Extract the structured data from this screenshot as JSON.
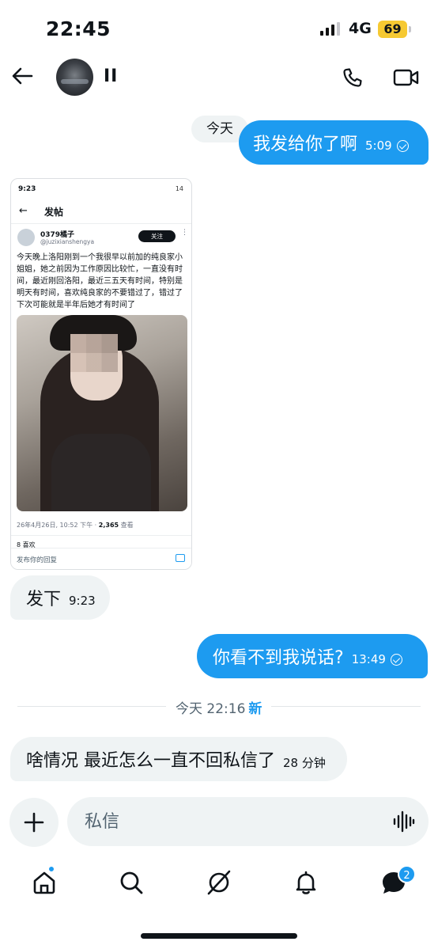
{
  "status": {
    "time": "22:45",
    "network": "4G",
    "battery": "69"
  },
  "header": {
    "contact_name": "II"
  },
  "conversation": {
    "date_chip": "今天",
    "messages": [
      {
        "text": "我发给你了啊",
        "time": "5:09",
        "direction": "out"
      },
      {
        "text": "发下",
        "time": "9:23",
        "direction": "in"
      },
      {
        "text": "你看不到我说话?",
        "time": "13:49",
        "direction": "out"
      },
      {
        "text": "啥情况 最近怎么一直不回私信了",
        "time": "28 分钟",
        "direction": "in"
      }
    ],
    "divider": {
      "label": "今天 22:16",
      "new_label": "新"
    }
  },
  "shared_screenshot": {
    "status_time": "9:23",
    "status_right": "14",
    "page_title": "发帖",
    "author_name": "0379橘子",
    "author_handle": "@juzixianshengya",
    "follow_label": "关注",
    "post_text": "今天晚上洛阳刚到一个我很早以前加的纯良家小姐姐，她之前因为工作原因比较忙，一直没有时间，最近刚回洛阳，最近三五天有时间，特别是明天有时间，喜欢纯良家的不要错过了，错过了下次可能就是半年后她才有时间了",
    "post_date": "26年4月26日, 10:52 下午 · ",
    "views_count": "2,365",
    "views_label": " 查看",
    "likes": "8 喜欢",
    "reply_placeholder": "发布你的回复"
  },
  "composer": {
    "placeholder": "私信"
  },
  "tabbar": {
    "dm_badge": "2"
  },
  "colors": {
    "accent": "#1d9bf0",
    "incoming_bubble": "#eff3f4",
    "battery": "#f6c932"
  }
}
